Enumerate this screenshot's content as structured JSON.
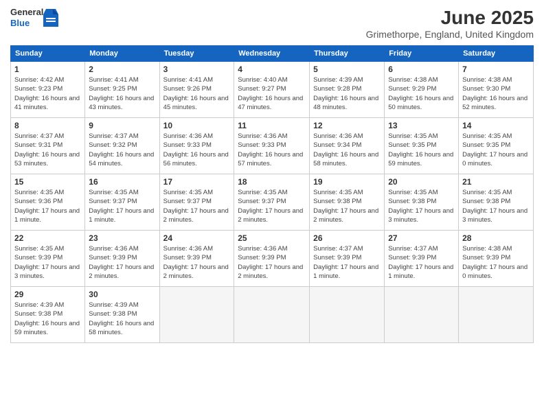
{
  "header": {
    "logo_general": "General",
    "logo_blue": "Blue",
    "month_title": "June 2025",
    "location": "Grimethorpe, England, United Kingdom"
  },
  "weekdays": [
    "Sunday",
    "Monday",
    "Tuesday",
    "Wednesday",
    "Thursday",
    "Friday",
    "Saturday"
  ],
  "weeks": [
    [
      {
        "day": 1,
        "info": "Sunrise: 4:42 AM\nSunset: 9:23 PM\nDaylight: 16 hours and 41 minutes."
      },
      {
        "day": 2,
        "info": "Sunrise: 4:41 AM\nSunset: 9:25 PM\nDaylight: 16 hours and 43 minutes."
      },
      {
        "day": 3,
        "info": "Sunrise: 4:41 AM\nSunset: 9:26 PM\nDaylight: 16 hours and 45 minutes."
      },
      {
        "day": 4,
        "info": "Sunrise: 4:40 AM\nSunset: 9:27 PM\nDaylight: 16 hours and 47 minutes."
      },
      {
        "day": 5,
        "info": "Sunrise: 4:39 AM\nSunset: 9:28 PM\nDaylight: 16 hours and 48 minutes."
      },
      {
        "day": 6,
        "info": "Sunrise: 4:38 AM\nSunset: 9:29 PM\nDaylight: 16 hours and 50 minutes."
      },
      {
        "day": 7,
        "info": "Sunrise: 4:38 AM\nSunset: 9:30 PM\nDaylight: 16 hours and 52 minutes."
      }
    ],
    [
      {
        "day": 8,
        "info": "Sunrise: 4:37 AM\nSunset: 9:31 PM\nDaylight: 16 hours and 53 minutes."
      },
      {
        "day": 9,
        "info": "Sunrise: 4:37 AM\nSunset: 9:32 PM\nDaylight: 16 hours and 54 minutes."
      },
      {
        "day": 10,
        "info": "Sunrise: 4:36 AM\nSunset: 9:33 PM\nDaylight: 16 hours and 56 minutes."
      },
      {
        "day": 11,
        "info": "Sunrise: 4:36 AM\nSunset: 9:33 PM\nDaylight: 16 hours and 57 minutes."
      },
      {
        "day": 12,
        "info": "Sunrise: 4:36 AM\nSunset: 9:34 PM\nDaylight: 16 hours and 58 minutes."
      },
      {
        "day": 13,
        "info": "Sunrise: 4:35 AM\nSunset: 9:35 PM\nDaylight: 16 hours and 59 minutes."
      },
      {
        "day": 14,
        "info": "Sunrise: 4:35 AM\nSunset: 9:35 PM\nDaylight: 17 hours and 0 minutes."
      }
    ],
    [
      {
        "day": 15,
        "info": "Sunrise: 4:35 AM\nSunset: 9:36 PM\nDaylight: 17 hours and 1 minute."
      },
      {
        "day": 16,
        "info": "Sunrise: 4:35 AM\nSunset: 9:37 PM\nDaylight: 17 hours and 1 minute."
      },
      {
        "day": 17,
        "info": "Sunrise: 4:35 AM\nSunset: 9:37 PM\nDaylight: 17 hours and 2 minutes."
      },
      {
        "day": 18,
        "info": "Sunrise: 4:35 AM\nSunset: 9:37 PM\nDaylight: 17 hours and 2 minutes."
      },
      {
        "day": 19,
        "info": "Sunrise: 4:35 AM\nSunset: 9:38 PM\nDaylight: 17 hours and 2 minutes."
      },
      {
        "day": 20,
        "info": "Sunrise: 4:35 AM\nSunset: 9:38 PM\nDaylight: 17 hours and 3 minutes."
      },
      {
        "day": 21,
        "info": "Sunrise: 4:35 AM\nSunset: 9:38 PM\nDaylight: 17 hours and 3 minutes."
      }
    ],
    [
      {
        "day": 22,
        "info": "Sunrise: 4:35 AM\nSunset: 9:39 PM\nDaylight: 17 hours and 3 minutes."
      },
      {
        "day": 23,
        "info": "Sunrise: 4:36 AM\nSunset: 9:39 PM\nDaylight: 17 hours and 2 minutes."
      },
      {
        "day": 24,
        "info": "Sunrise: 4:36 AM\nSunset: 9:39 PM\nDaylight: 17 hours and 2 minutes."
      },
      {
        "day": 25,
        "info": "Sunrise: 4:36 AM\nSunset: 9:39 PM\nDaylight: 17 hours and 2 minutes."
      },
      {
        "day": 26,
        "info": "Sunrise: 4:37 AM\nSunset: 9:39 PM\nDaylight: 17 hours and 1 minute."
      },
      {
        "day": 27,
        "info": "Sunrise: 4:37 AM\nSunset: 9:39 PM\nDaylight: 17 hours and 1 minute."
      },
      {
        "day": 28,
        "info": "Sunrise: 4:38 AM\nSunset: 9:39 PM\nDaylight: 17 hours and 0 minutes."
      }
    ],
    [
      {
        "day": 29,
        "info": "Sunrise: 4:39 AM\nSunset: 9:38 PM\nDaylight: 16 hours and 59 minutes."
      },
      {
        "day": 30,
        "info": "Sunrise: 4:39 AM\nSunset: 9:38 PM\nDaylight: 16 hours and 58 minutes."
      },
      null,
      null,
      null,
      null,
      null
    ]
  ]
}
